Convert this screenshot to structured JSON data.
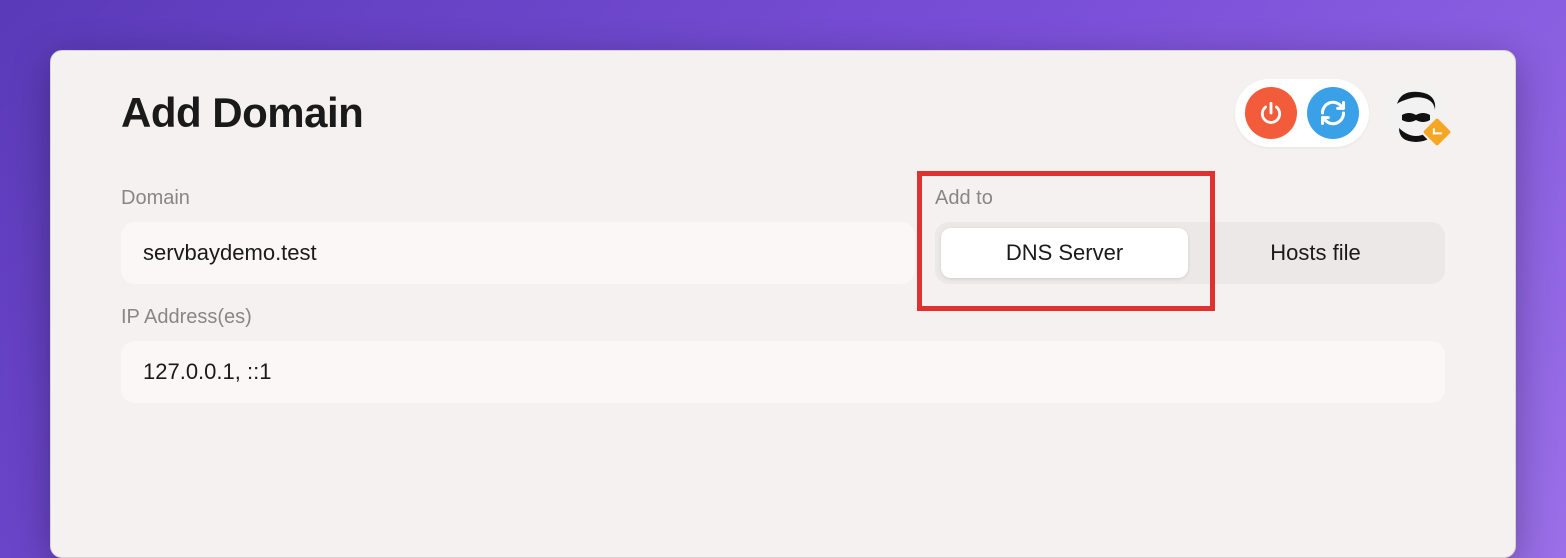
{
  "header": {
    "title": "Add Domain"
  },
  "form": {
    "domain": {
      "label": "Domain",
      "value": "servbaydemo.test"
    },
    "add_to": {
      "label": "Add to",
      "options": [
        "DNS Server",
        "Hosts file"
      ],
      "selected": "DNS Server"
    },
    "ip": {
      "label": "IP Address(es)",
      "value": "127.0.0.1, ::1"
    }
  },
  "icons": {
    "power": "power-icon",
    "refresh": "refresh-icon",
    "avatar": "avatar"
  },
  "colors": {
    "power_bg": "#f25c3a",
    "refresh_bg": "#3aa0e8",
    "badge_bg": "#f5a623",
    "highlight": "#e03131"
  }
}
